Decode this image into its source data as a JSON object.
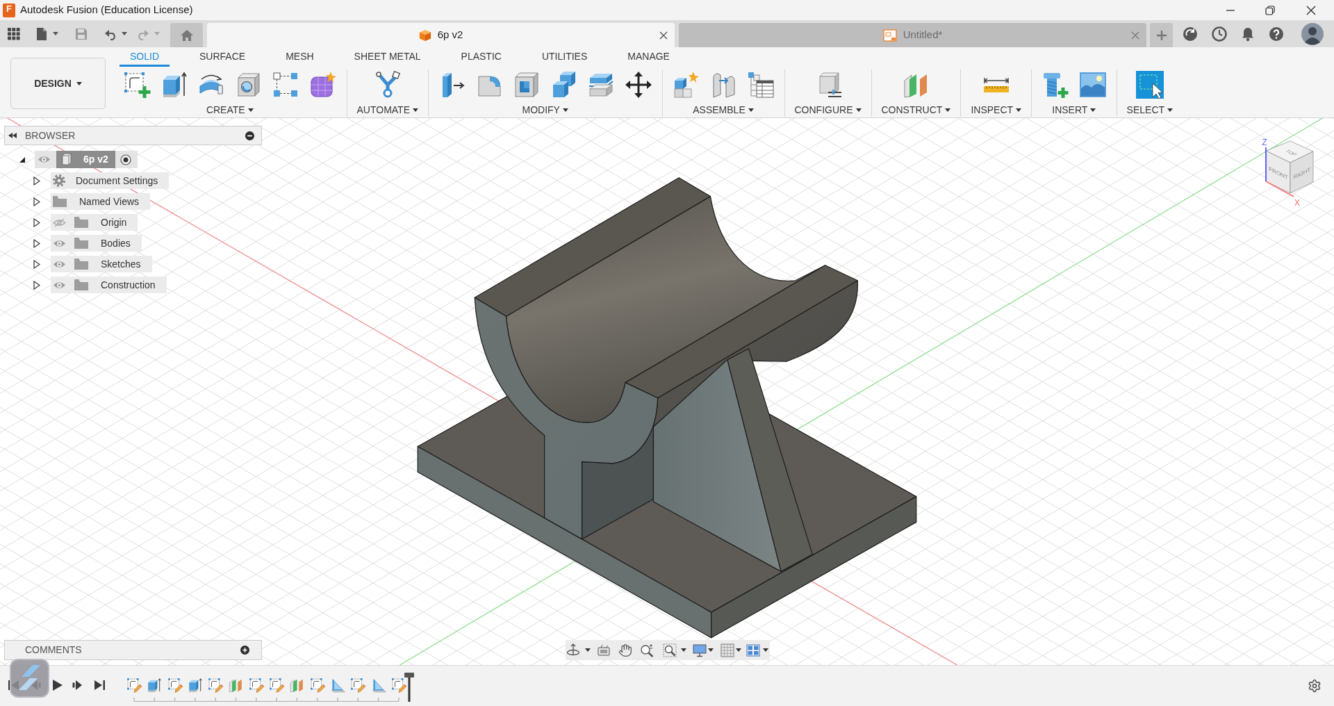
{
  "window": {
    "logo": "F",
    "title": "Autodesk Fusion (Education License)"
  },
  "document_tabs": [
    {
      "label": "6p v2",
      "kind": "design",
      "selected": true
    },
    {
      "label": "Untitled*",
      "kind": "drawing",
      "selected": false
    }
  ],
  "toolbar": {
    "workspace": "DESIGN",
    "tabs": [
      {
        "label": "SOLID",
        "selected": true
      },
      {
        "label": "SURFACE",
        "selected": false
      },
      {
        "label": "MESH",
        "selected": false
      },
      {
        "label": "SHEET METAL",
        "selected": false
      },
      {
        "label": "PLASTIC",
        "selected": false
      },
      {
        "label": "UTILITIES",
        "selected": false
      },
      {
        "label": "MANAGE",
        "selected": false
      }
    ],
    "groups": [
      {
        "label": "CREATE",
        "tools": [
          {
            "kind": "sketch"
          },
          {
            "kind": "extrude"
          },
          {
            "kind": "revolve"
          },
          {
            "kind": "hole"
          },
          {
            "kind": "pattern"
          },
          {
            "kind": "form"
          }
        ]
      },
      {
        "label": "AUTOMATE",
        "tools": [
          {
            "kind": "automate"
          }
        ]
      },
      {
        "label": "MODIFY",
        "tools": [
          {
            "kind": "press_pull"
          },
          {
            "kind": "fillet"
          },
          {
            "kind": "shell"
          },
          {
            "kind": "combine"
          },
          {
            "kind": "offset"
          },
          {
            "kind": "move"
          }
        ]
      },
      {
        "label": "ASSEMBLE",
        "tools": [
          {
            "kind": "component"
          },
          {
            "kind": "joint"
          },
          {
            "kind": "table"
          }
        ]
      },
      {
        "label": "CONFIGURE",
        "tools": [
          {
            "kind": "configure"
          }
        ]
      },
      {
        "label": "CONSTRUCT",
        "tools": [
          {
            "kind": "plane"
          }
        ]
      },
      {
        "label": "INSPECT",
        "tools": [
          {
            "kind": "measure"
          }
        ]
      },
      {
        "label": "INSERT",
        "tools": [
          {
            "kind": "bolt"
          },
          {
            "kind": "image"
          }
        ]
      },
      {
        "label": "SELECT",
        "tools": [
          {
            "kind": "select"
          }
        ]
      }
    ]
  },
  "browser": {
    "title": "BROWSER",
    "root": {
      "label": "6p v2",
      "expanded": true,
      "visible": true,
      "active": true,
      "children": [
        {
          "label": "Document Settings",
          "kind": "settings",
          "expanded": false
        },
        {
          "label": "Named Views",
          "kind": "views",
          "expanded": false
        },
        {
          "label": "Origin",
          "kind": "folder",
          "expanded": false,
          "visible": false
        },
        {
          "label": "Bodies",
          "kind": "folder",
          "expanded": false,
          "visible": true
        },
        {
          "label": "Sketches",
          "kind": "folder",
          "expanded": false,
          "visible": true
        },
        {
          "label": "Construction",
          "kind": "folder",
          "expanded": false,
          "visible": true
        }
      ]
    }
  },
  "view_cube": {
    "top": "TOP",
    "front": "FRONT",
    "right": "RIGHT",
    "axes": [
      "Z",
      "X"
    ]
  },
  "comments": {
    "title": "COMMENTS"
  },
  "timeline": {
    "features": [
      {
        "kind": "sketch"
      },
      {
        "kind": "extrude"
      },
      {
        "kind": "sketch"
      },
      {
        "kind": "extrude"
      },
      {
        "kind": "sketch"
      },
      {
        "kind": "plane"
      },
      {
        "kind": "sketch"
      },
      {
        "kind": "sketch"
      },
      {
        "kind": "plane"
      },
      {
        "kind": "sketch"
      },
      {
        "kind": "web"
      },
      {
        "kind": "sketch"
      },
      {
        "kind": "web"
      },
      {
        "kind": "sketch"
      }
    ]
  }
}
